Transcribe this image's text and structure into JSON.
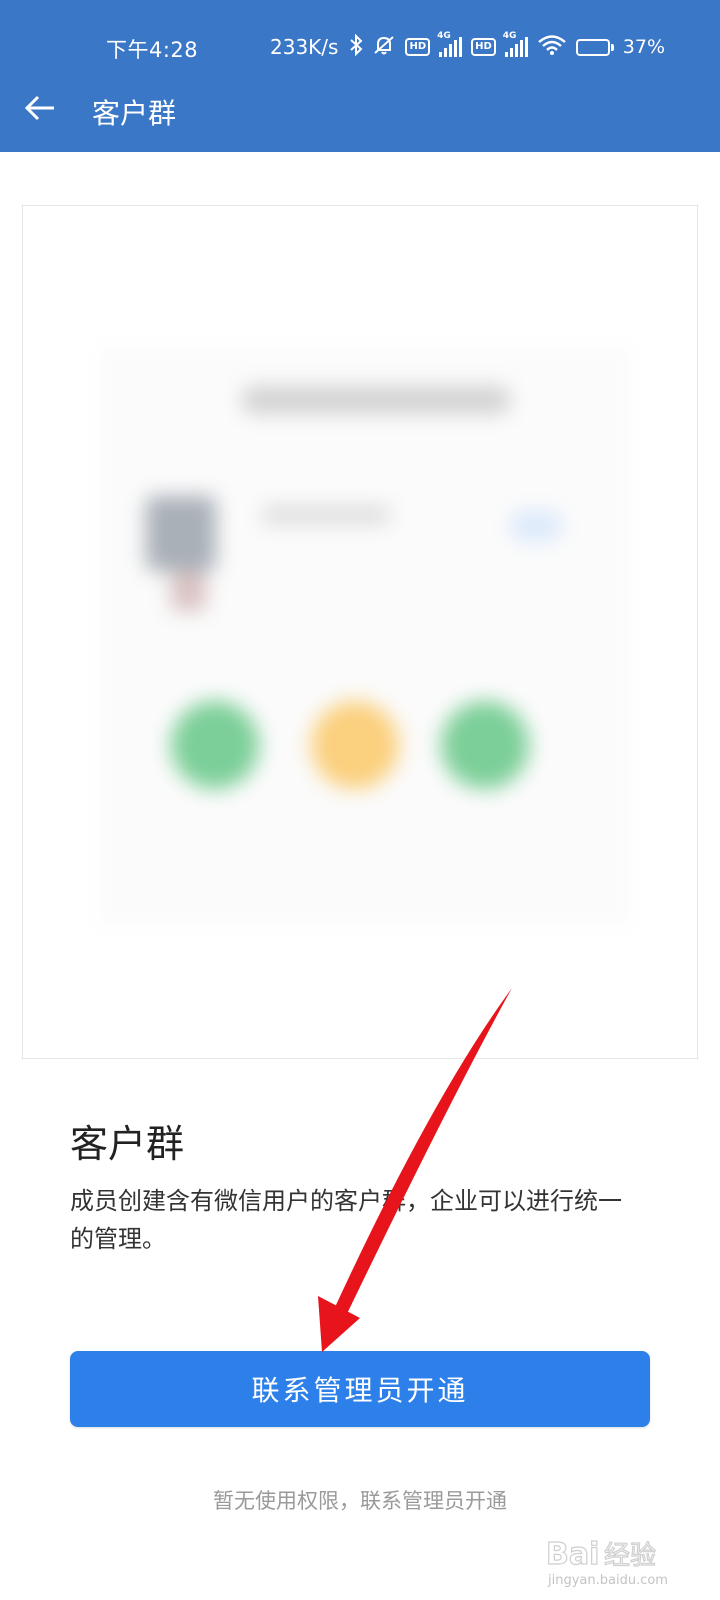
{
  "status_bar": {
    "time": "下午4:28",
    "net_speed": "233K/s",
    "hd_label": "HD",
    "network_type": "4G",
    "battery_percent_text": "37%",
    "battery_level": 0.37
  },
  "nav": {
    "title": "客户群",
    "back_icon": "arrow-left-icon"
  },
  "feature": {
    "title": "客户群",
    "description": "成员创建含有微信用户的客户群，企业可以进行统一的管理。"
  },
  "actions": {
    "contact_admin_label": "联系管理员开通",
    "hint": "暂无使用权限，联系管理员开通"
  },
  "colors": {
    "header_bg": "#3a77c6",
    "primary_button": "#2d7fe9",
    "annotation_arrow": "#e8141c"
  },
  "watermark": {
    "brand": "Bai",
    "brand_suffix": "经验",
    "url": "jingyan.baidu.com"
  }
}
